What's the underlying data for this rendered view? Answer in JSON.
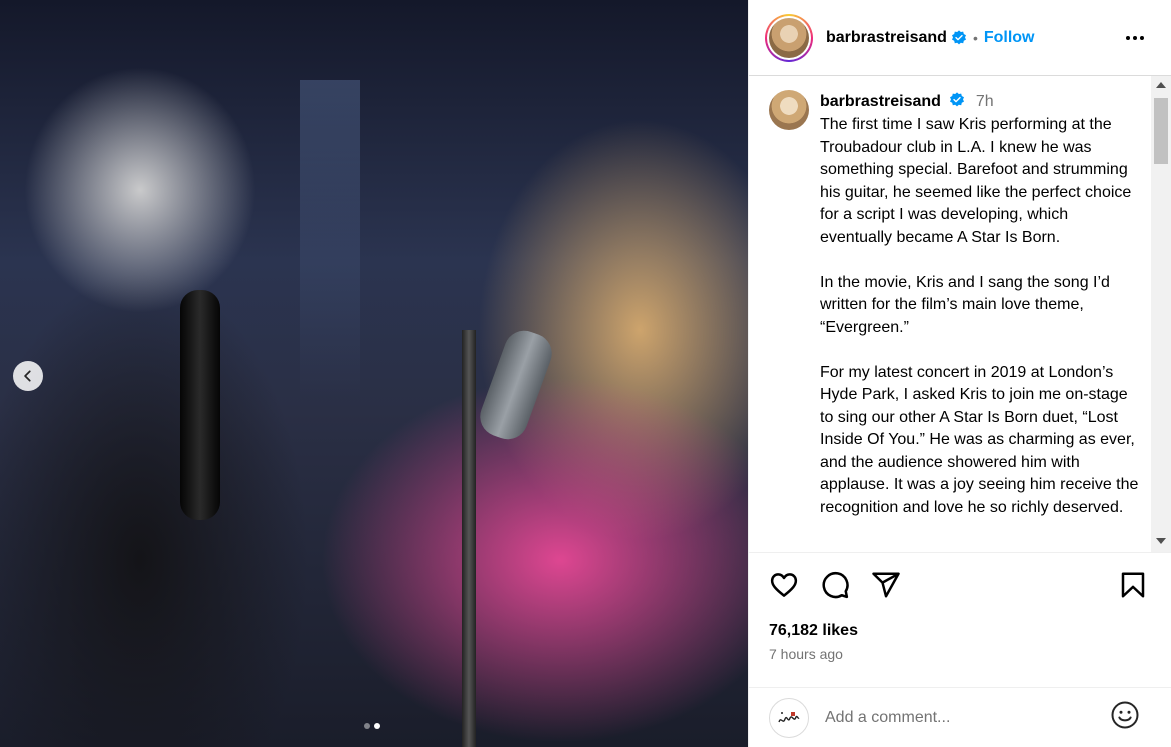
{
  "post": {
    "username": "barbrastreisand",
    "follow_label": "Follow",
    "bullet": "•",
    "time_short": "7h",
    "caption_paragraphs": [
      "The first time I saw Kris performing at the Troubadour club in L.A. I knew he was something special. Barefoot and strumming his guitar, he seemed like the perfect choice for a script I was developing, which eventually became A Star Is Born.",
      "In the movie, Kris and I sang the song I’d written for the film’s main love theme, “Evergreen.”",
      "For my latest concert in 2019 at London’s Hyde Park, I asked Kris to join me on-stage to sing our other A Star Is Born duet, “Lost Inside Of You.” He was as charming as ever, and the audience showered him with applause. It was a joy seeing him receive the recognition and love he so richly deserved."
    ],
    "likes": "76,182 likes",
    "time_ago": "7 hours ago"
  },
  "carousel": {
    "slide_count": 2,
    "active_index": 1
  },
  "comment_box": {
    "placeholder": "Add a comment..."
  },
  "icons": {
    "verified": "verified-badge-icon",
    "more": "more-options-icon",
    "like": "heart-icon",
    "comment": "comment-bubble-icon",
    "share": "paper-plane-icon",
    "save": "bookmark-icon",
    "emoji": "emoji-icon",
    "prev": "chevron-left-icon"
  },
  "colors": {
    "accent": "#0095f6",
    "muted": "#737373",
    "border": "#dbdbdb"
  }
}
